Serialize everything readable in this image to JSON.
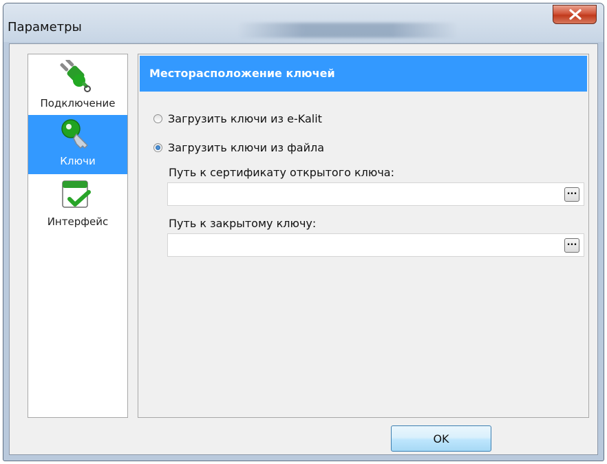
{
  "window": {
    "title": "Параметры"
  },
  "sidebar": {
    "items": [
      {
        "label": "Подключение",
        "icon": "plug-icon",
        "selected": false
      },
      {
        "label": "Ключи",
        "icon": "key-icon",
        "selected": true
      },
      {
        "label": "Интерфейс",
        "icon": "calendar-check-icon",
        "selected": false
      }
    ]
  },
  "main": {
    "header": "Месторасположение ключей",
    "options": [
      {
        "label": "Загрузить ключи из e-Kalit",
        "checked": false
      },
      {
        "label": "Загрузить ключи из файла",
        "checked": true
      }
    ],
    "cert_path": {
      "label": "Путь к сертификату открытого ключа:",
      "value": "",
      "browse_label": "..."
    },
    "key_path": {
      "label": "Путь к закрытому ключу:",
      "value": "",
      "browse_label": "..."
    }
  },
  "footer": {
    "ok_label": "OK"
  },
  "colors": {
    "accent": "#3399ff",
    "window_bg": "#f0f0f0",
    "close_button": "#c13a1c"
  }
}
